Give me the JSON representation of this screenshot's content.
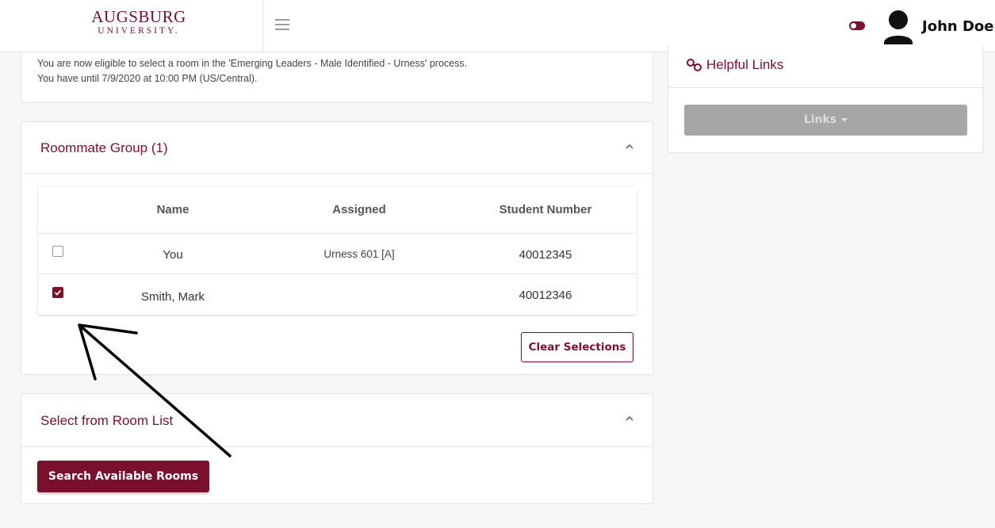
{
  "header": {
    "logo_main": "AUGSBURG",
    "logo_sub": "UNIVERSITY.",
    "user_name": "John Doe",
    "accent_color": "#7a0f2e"
  },
  "notice": {
    "line1": "You are now eligible to select a room in the 'Emerging Leaders - Male Identified - Urness' process.",
    "line2": "You have until 7/9/2020 at 10:00 PM (US/Central)."
  },
  "roommate_group": {
    "title": "Roommate Group (1)",
    "columns": [
      "Name",
      "Assigned",
      "Student Number"
    ],
    "rows": [
      {
        "name": "You",
        "assigned": "Urness 601 [A]",
        "student_number": "40012345",
        "checked": false
      },
      {
        "name": "Smith, Mark",
        "assigned": "",
        "student_number": "40012346",
        "checked": true
      }
    ],
    "clear_label": "Clear Selections"
  },
  "room_list": {
    "title": "Select from Room List",
    "search_label": "Search Available Rooms"
  },
  "helpful_links": {
    "title": "Helpful Links",
    "button_label": "Links"
  }
}
